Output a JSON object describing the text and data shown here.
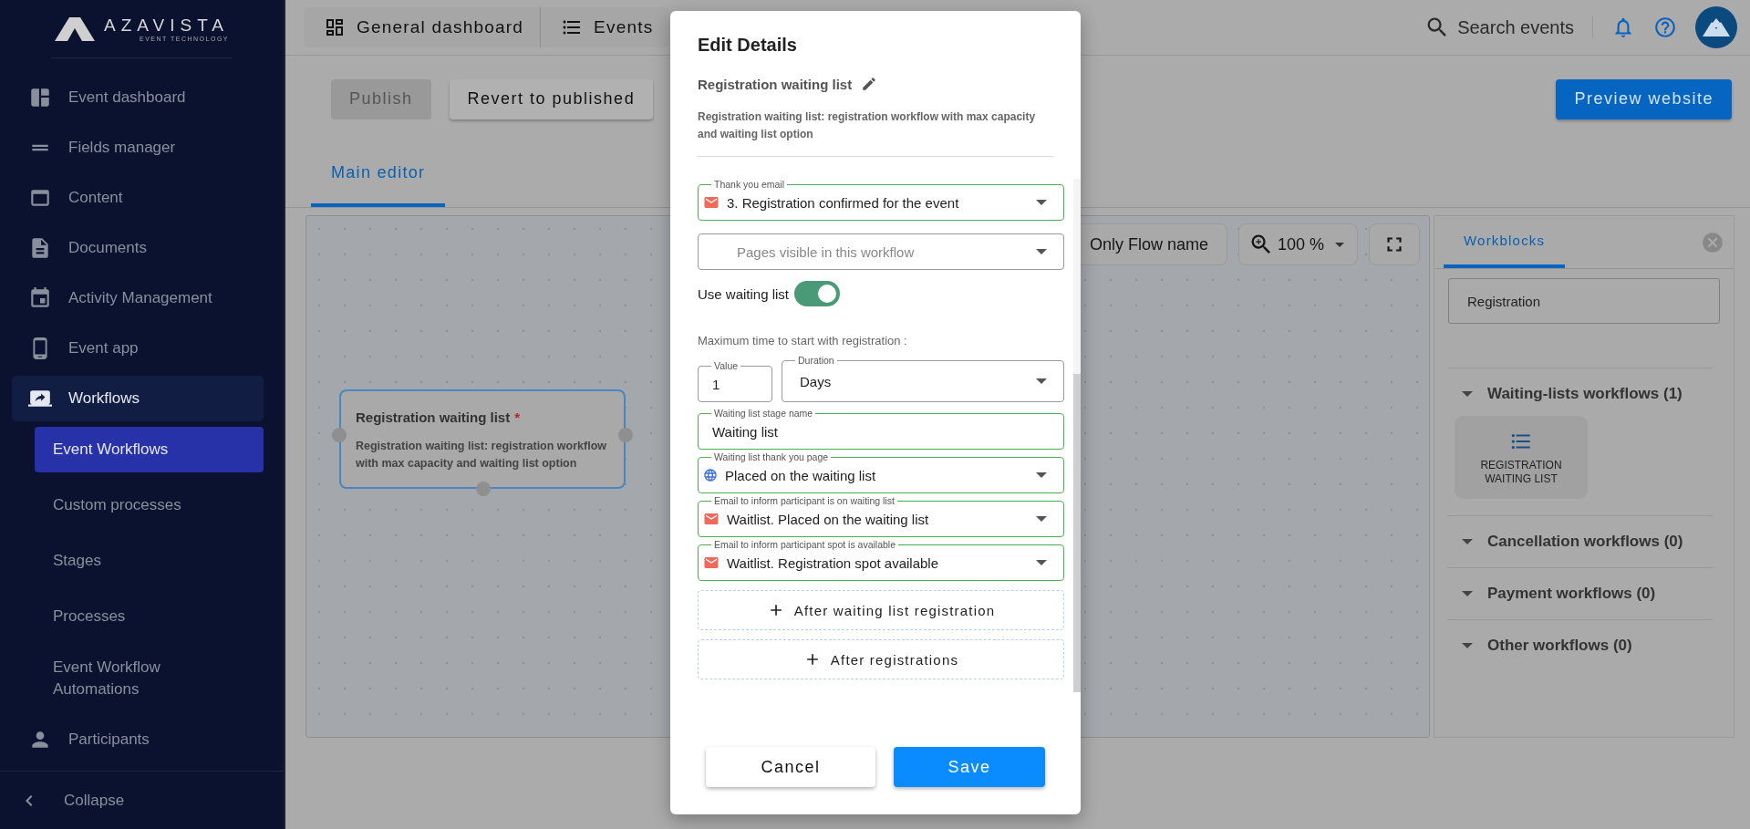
{
  "brand": {
    "name": "AZAVISTA",
    "tagline": "EVENT TECHNOLOGY"
  },
  "sidebar": {
    "items": [
      {
        "label": "Event dashboard",
        "selected": false
      },
      {
        "label": "Fields manager",
        "selected": false
      },
      {
        "label": "Content",
        "selected": false
      },
      {
        "label": "Documents",
        "selected": false
      },
      {
        "label": "Activity Management",
        "selected": false
      },
      {
        "label": "Event app",
        "selected": false
      },
      {
        "label": "Workflows",
        "selected": true,
        "children": [
          {
            "label": "Event Workflows",
            "selected": true
          },
          {
            "label": "Custom processes",
            "selected": false
          },
          {
            "label": "Stages",
            "selected": false
          },
          {
            "label": "Processes",
            "selected": false
          },
          {
            "label": "Event Workflow Automations",
            "selected": false
          }
        ]
      },
      {
        "label": "Participants",
        "selected": false
      }
    ],
    "collapse": "Collapse"
  },
  "topbar": {
    "nav": [
      "General dashboard",
      "Events"
    ],
    "search": {
      "placeholder": "Search events"
    }
  },
  "toolbar": {
    "publish": {
      "label": "Publish",
      "disabled": true
    },
    "revert": {
      "label": "Revert to published"
    },
    "preview": {
      "label": "Preview website"
    }
  },
  "tabs": [
    {
      "label": "Main editor",
      "selected": true
    }
  ],
  "canvas": {
    "view_label": "Only Flow name",
    "zoom": "100 %",
    "node": {
      "title": "Registration waiting list",
      "required_mark": "*",
      "description": "Registration waiting list: registration workflow with max capacity and waiting list option"
    }
  },
  "workblocks": {
    "tabs": [
      {
        "label": "Workblocks",
        "selected": true
      }
    ],
    "search": {
      "value": "Registration"
    },
    "groups": [
      {
        "title": "Waiting-lists workflows (1)",
        "blocks": [
          "REGISTRATION WAITING LIST"
        ]
      },
      {
        "title": "Cancellation workflows (0)"
      },
      {
        "title": "Payment workflows (0)"
      },
      {
        "title": "Other workflows (0)"
      }
    ]
  },
  "modal": {
    "title": "Edit Details",
    "workflow_name": "Registration waiting list",
    "description": "Registration waiting list: registration workflow with max capacity and waiting list option",
    "fields": [
      {
        "kind": "email",
        "label": "Thank you email",
        "value": "3. Registration confirmed for the event"
      },
      {
        "kind": "select",
        "placeholder": "Pages visible in this workflow"
      },
      {
        "kind": "toggle",
        "label": "Use waiting list",
        "on": true
      },
      {
        "kind": "heading",
        "label": "Maximum time to start with registration :"
      },
      {
        "kind": "pair",
        "value_field": {
          "label": "Value",
          "value": "1"
        },
        "duration": {
          "label": "Duration",
          "value": "Days"
        }
      },
      {
        "kind": "text",
        "label": "Waiting list stage name",
        "value": "Waiting list"
      },
      {
        "kind": "page",
        "label": "Waiting list thank you page",
        "value": "Placed on the waiting list"
      },
      {
        "kind": "email",
        "label": "Email to inform participant is on waiting list",
        "value": "Waitlist. Placed on the waiting list"
      },
      {
        "kind": "email",
        "label": "Email to inform participant spot is available",
        "value": "Waitlist. Registration spot available"
      },
      {
        "kind": "add",
        "label": "After waiting list registration"
      },
      {
        "kind": "add",
        "label": "After registrations"
      }
    ],
    "buttons": {
      "cancel": "Cancel",
      "save": "Save"
    }
  }
}
